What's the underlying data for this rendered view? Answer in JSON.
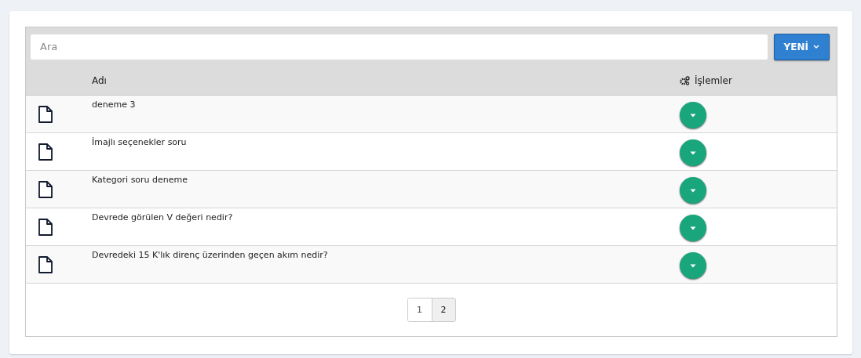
{
  "search": {
    "placeholder": "Ara"
  },
  "new_button": {
    "label": "YENİ"
  },
  "table": {
    "columns": [
      "Adı",
      "İşlemler"
    ],
    "rows": [
      {
        "name": "deneme 3"
      },
      {
        "name": "İmajlı seçenekler soru"
      },
      {
        "name": "Kategori soru deneme"
      },
      {
        "name": "Devrede görülen V değeri nedir?"
      },
      {
        "name": "Devredeki 15 K'lık direnç üzerinden geçen akım nedir?"
      }
    ]
  },
  "pagination": [
    {
      "label": "1",
      "selected": false
    },
    {
      "label": "2",
      "selected": true
    }
  ]
}
